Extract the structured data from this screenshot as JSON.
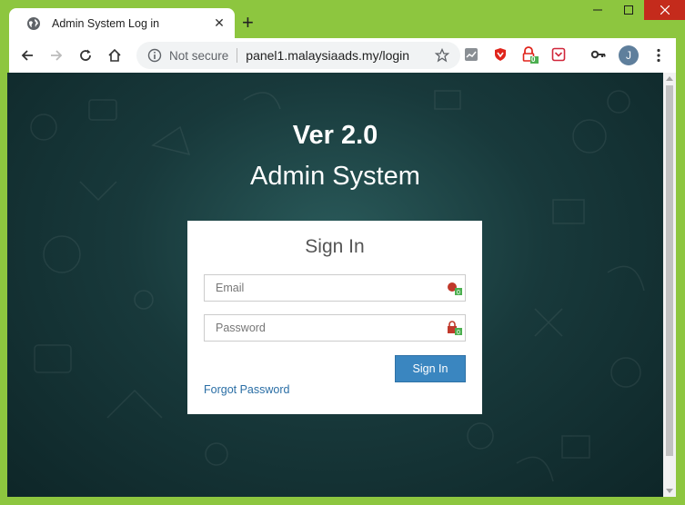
{
  "browser": {
    "tab_title": "Admin System Log in",
    "security_label": "Not secure",
    "url": "panel1.malaysiaads.my/login",
    "avatar_letter": "J",
    "extension_badge": "0"
  },
  "page": {
    "version": "Ver 2.0",
    "system_name": "Admin System",
    "form_title": "Sign In",
    "email_placeholder": "Email",
    "password_placeholder": "Password",
    "signin_button": "Sign In",
    "forgot_link": "Forgot Password"
  },
  "colors": {
    "frame": "#8dc63f",
    "button": "#3a86c0",
    "link": "#2a6ea5"
  }
}
